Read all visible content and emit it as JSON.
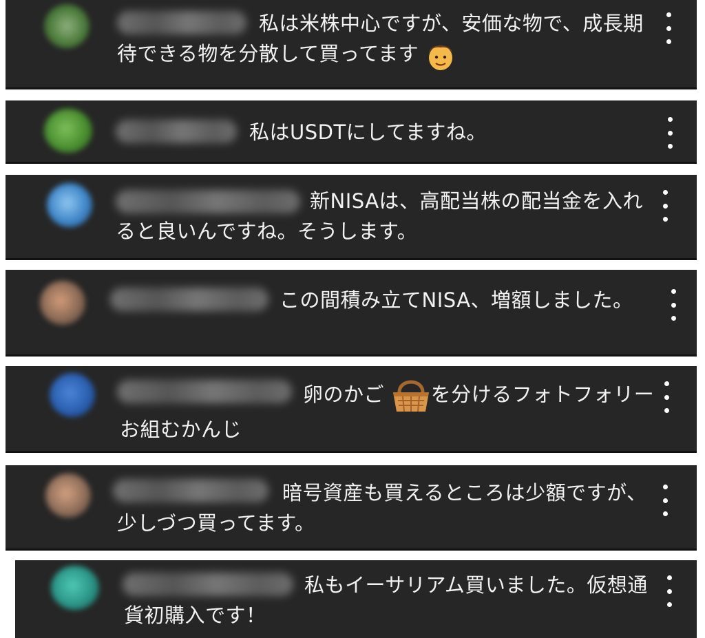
{
  "comments": [
    {
      "text": "私は米株中心ですが、安価な物で、成長期待できる物を分散して買ってます",
      "emoji": "man-emoji",
      "avatar_color": "#4e7e3e"
    },
    {
      "text": "私はUSDTにしてますね。",
      "avatar_color": "#4a8e32"
    },
    {
      "text": "新NISAは、高配当株の配当金を入れると良いんですね。そうします。",
      "avatar_color": "#3f86c9"
    },
    {
      "text": "この間積み立てNISA、増額しました。",
      "avatar_color": "#8a6a56"
    },
    {
      "text_before": "卵のかご",
      "emoji": "basket-emoji",
      "text_after": "を分けるフォトフォリーお組むかんじ",
      "avatar_color": "#2a5fb0"
    },
    {
      "text": "暗号資産も買えるところは少額ですが、少しづつ買ってます。",
      "avatar_color": "#8e6e5a"
    },
    {
      "text": "私もイーサリアム買いました。仮想通貨初購入です！",
      "avatar_color": "#2a9486"
    }
  ]
}
